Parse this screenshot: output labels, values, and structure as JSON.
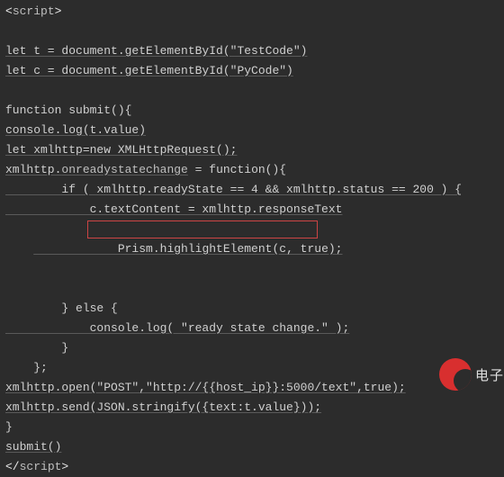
{
  "code": {
    "l1_open": "<",
    "l1_tag": "script",
    "l1_close": ">",
    "l2_spacer": "",
    "l3": "let t = document.getElementById(\"TestCode\")",
    "l4": "let c = document.getElementById(\"PyCode\")",
    "l5_spacer": "",
    "l6": "function submit(){",
    "l7": "console.log(t.value)",
    "l8": "let xmlhttp=new XMLHttpRequest();",
    "l9_pre": "xmlhttp.",
    "l9_mid": "onreadystatechange",
    "l9_post": " = function(){",
    "l10": "        if ( xmlhttp.readyState == 4 && xmlhttp.status == 200 ) {",
    "l11": "            c.textContent = xmlhttp.responseText",
    "l12": "            Prism.highlightElement(c, true);",
    "l13": "        } else {",
    "l14": "            console.log( \"ready state change.\" );",
    "l15": "        }",
    "l16": "    };",
    "l17": "xmlhttp.open(\"POST\",\"http://{{host_ip}}:5000/text\",true);",
    "l18": "xmlhttp.send(JSON.stringify({text:t.value}));",
    "l19": "}",
    "l20": "submit()",
    "l21_open": "</",
    "l21_tag": "script",
    "l21_close": ">"
  },
  "highlight": {
    "line_index": 12,
    "text": "Prism.highlightElement(c, true);"
  },
  "watermark": {
    "logo_name": "red-swirl-logo",
    "text": "电子"
  }
}
